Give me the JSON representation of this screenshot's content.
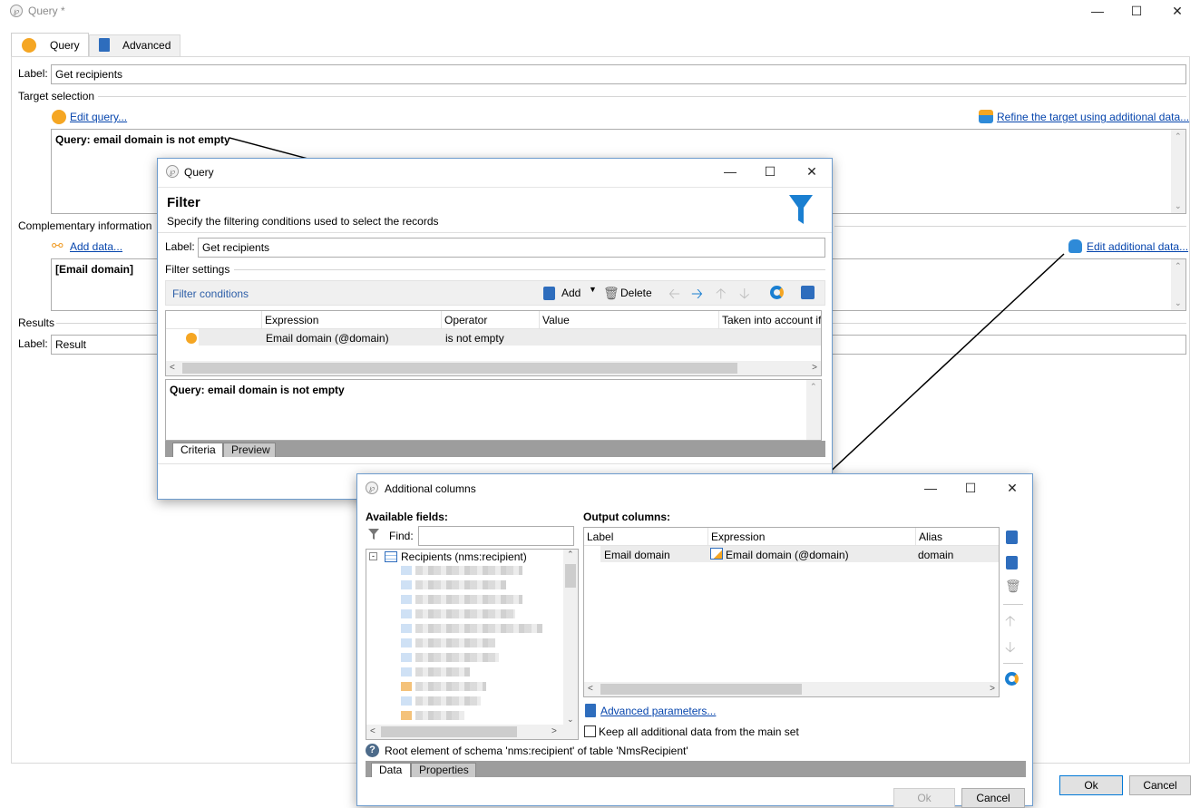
{
  "main_window": {
    "title": "Query *",
    "tabs": [
      {
        "label": "Query"
      },
      {
        "label": "Advanced"
      }
    ],
    "label_caption": "Label:",
    "label_value": "Get recipients",
    "target_selection": "Target selection",
    "edit_query": "Edit query...",
    "refine_link": "Refine the target using additional data...",
    "query_text": "Query: email domain is not empty",
    "complementary": "Complementary information",
    "add_data": "Add data...",
    "edit_additional": "Edit additional data...",
    "complementary_text": "[Email domain]",
    "results": "Results",
    "result_label_caption": "Label:",
    "result_label_value": "Result",
    "ok": "Ok",
    "cancel": "Cancel"
  },
  "query_dialog": {
    "title": "Query",
    "heading": "Filter",
    "subheading": "Specify the filtering conditions used to select the records",
    "label_caption": "Label:",
    "label_value": "Get recipients",
    "filter_settings": "Filter settings",
    "filter_conditions": "Filter conditions",
    "add": "Add",
    "delete": "Delete",
    "columns": [
      "Expression",
      "Operator",
      "Value",
      "Taken into account if"
    ],
    "row": {
      "expression": "Email domain (@domain)",
      "operator": "is not empty",
      "value": ""
    },
    "query_text": "Query: email domain is not empty",
    "tabs": [
      {
        "label": "Criteria"
      },
      {
        "label": "Preview"
      }
    ]
  },
  "columns_dialog": {
    "title": "Additional columns",
    "available_fields": "Available fields:",
    "find": "Find:",
    "root_node": "Recipients (nms:recipient)",
    "output_columns": "Output columns:",
    "columns": [
      "Label",
      "Expression",
      "Alias"
    ],
    "row": {
      "label": "Email domain",
      "expression": "Email domain (@domain)",
      "alias": "domain"
    },
    "advanced_params": "Advanced parameters...",
    "keep_all": "Keep all additional data from the main set",
    "status": "Root element of schema 'nms:recipient' of table 'NmsRecipient'",
    "tabs": [
      {
        "label": "Data"
      },
      {
        "label": "Properties"
      }
    ],
    "ok": "Ok",
    "cancel": "Cancel"
  },
  "colors": {
    "accent_link": "#0645ad",
    "orange": "#f5a623",
    "blue_icon": "#1a7fd1",
    "window_border": "#6d9cce"
  }
}
